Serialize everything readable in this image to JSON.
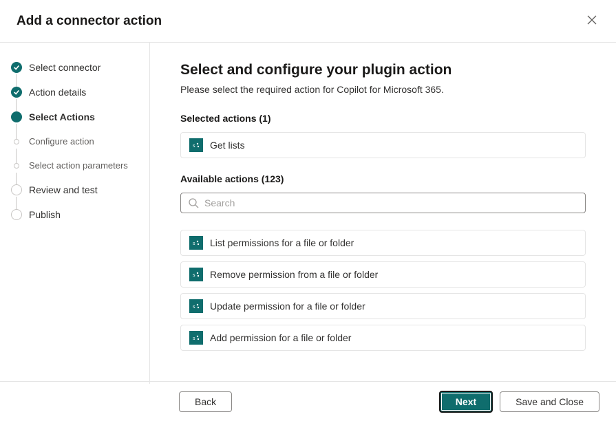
{
  "header": {
    "title": "Add a connector action"
  },
  "steps": [
    {
      "label": "Select connector",
      "state": "completed"
    },
    {
      "label": "Action details",
      "state": "completed"
    },
    {
      "label": "Select Actions",
      "state": "current"
    },
    {
      "label": "Configure action",
      "state": "future-sub"
    },
    {
      "label": "Select action parameters",
      "state": "future-sub"
    },
    {
      "label": "Review and test",
      "state": "future"
    },
    {
      "label": "Publish",
      "state": "future"
    }
  ],
  "main": {
    "title": "Select and configure your plugin action",
    "subtitle": "Please select the required action for Copilot for Microsoft 365.",
    "selected_label": "Selected actions (1)",
    "available_label": "Available actions (123)",
    "search_placeholder": "Search",
    "selected_actions": [
      {
        "label": "Get lists"
      }
    ],
    "available_actions": [
      {
        "label": "List permissions for a file or folder"
      },
      {
        "label": "Remove permission from a file or folder"
      },
      {
        "label": "Update permission for a file or folder"
      },
      {
        "label": "Add permission for a file or folder"
      }
    ]
  },
  "footer": {
    "back": "Back",
    "next": "Next",
    "save_close": "Save and Close"
  }
}
